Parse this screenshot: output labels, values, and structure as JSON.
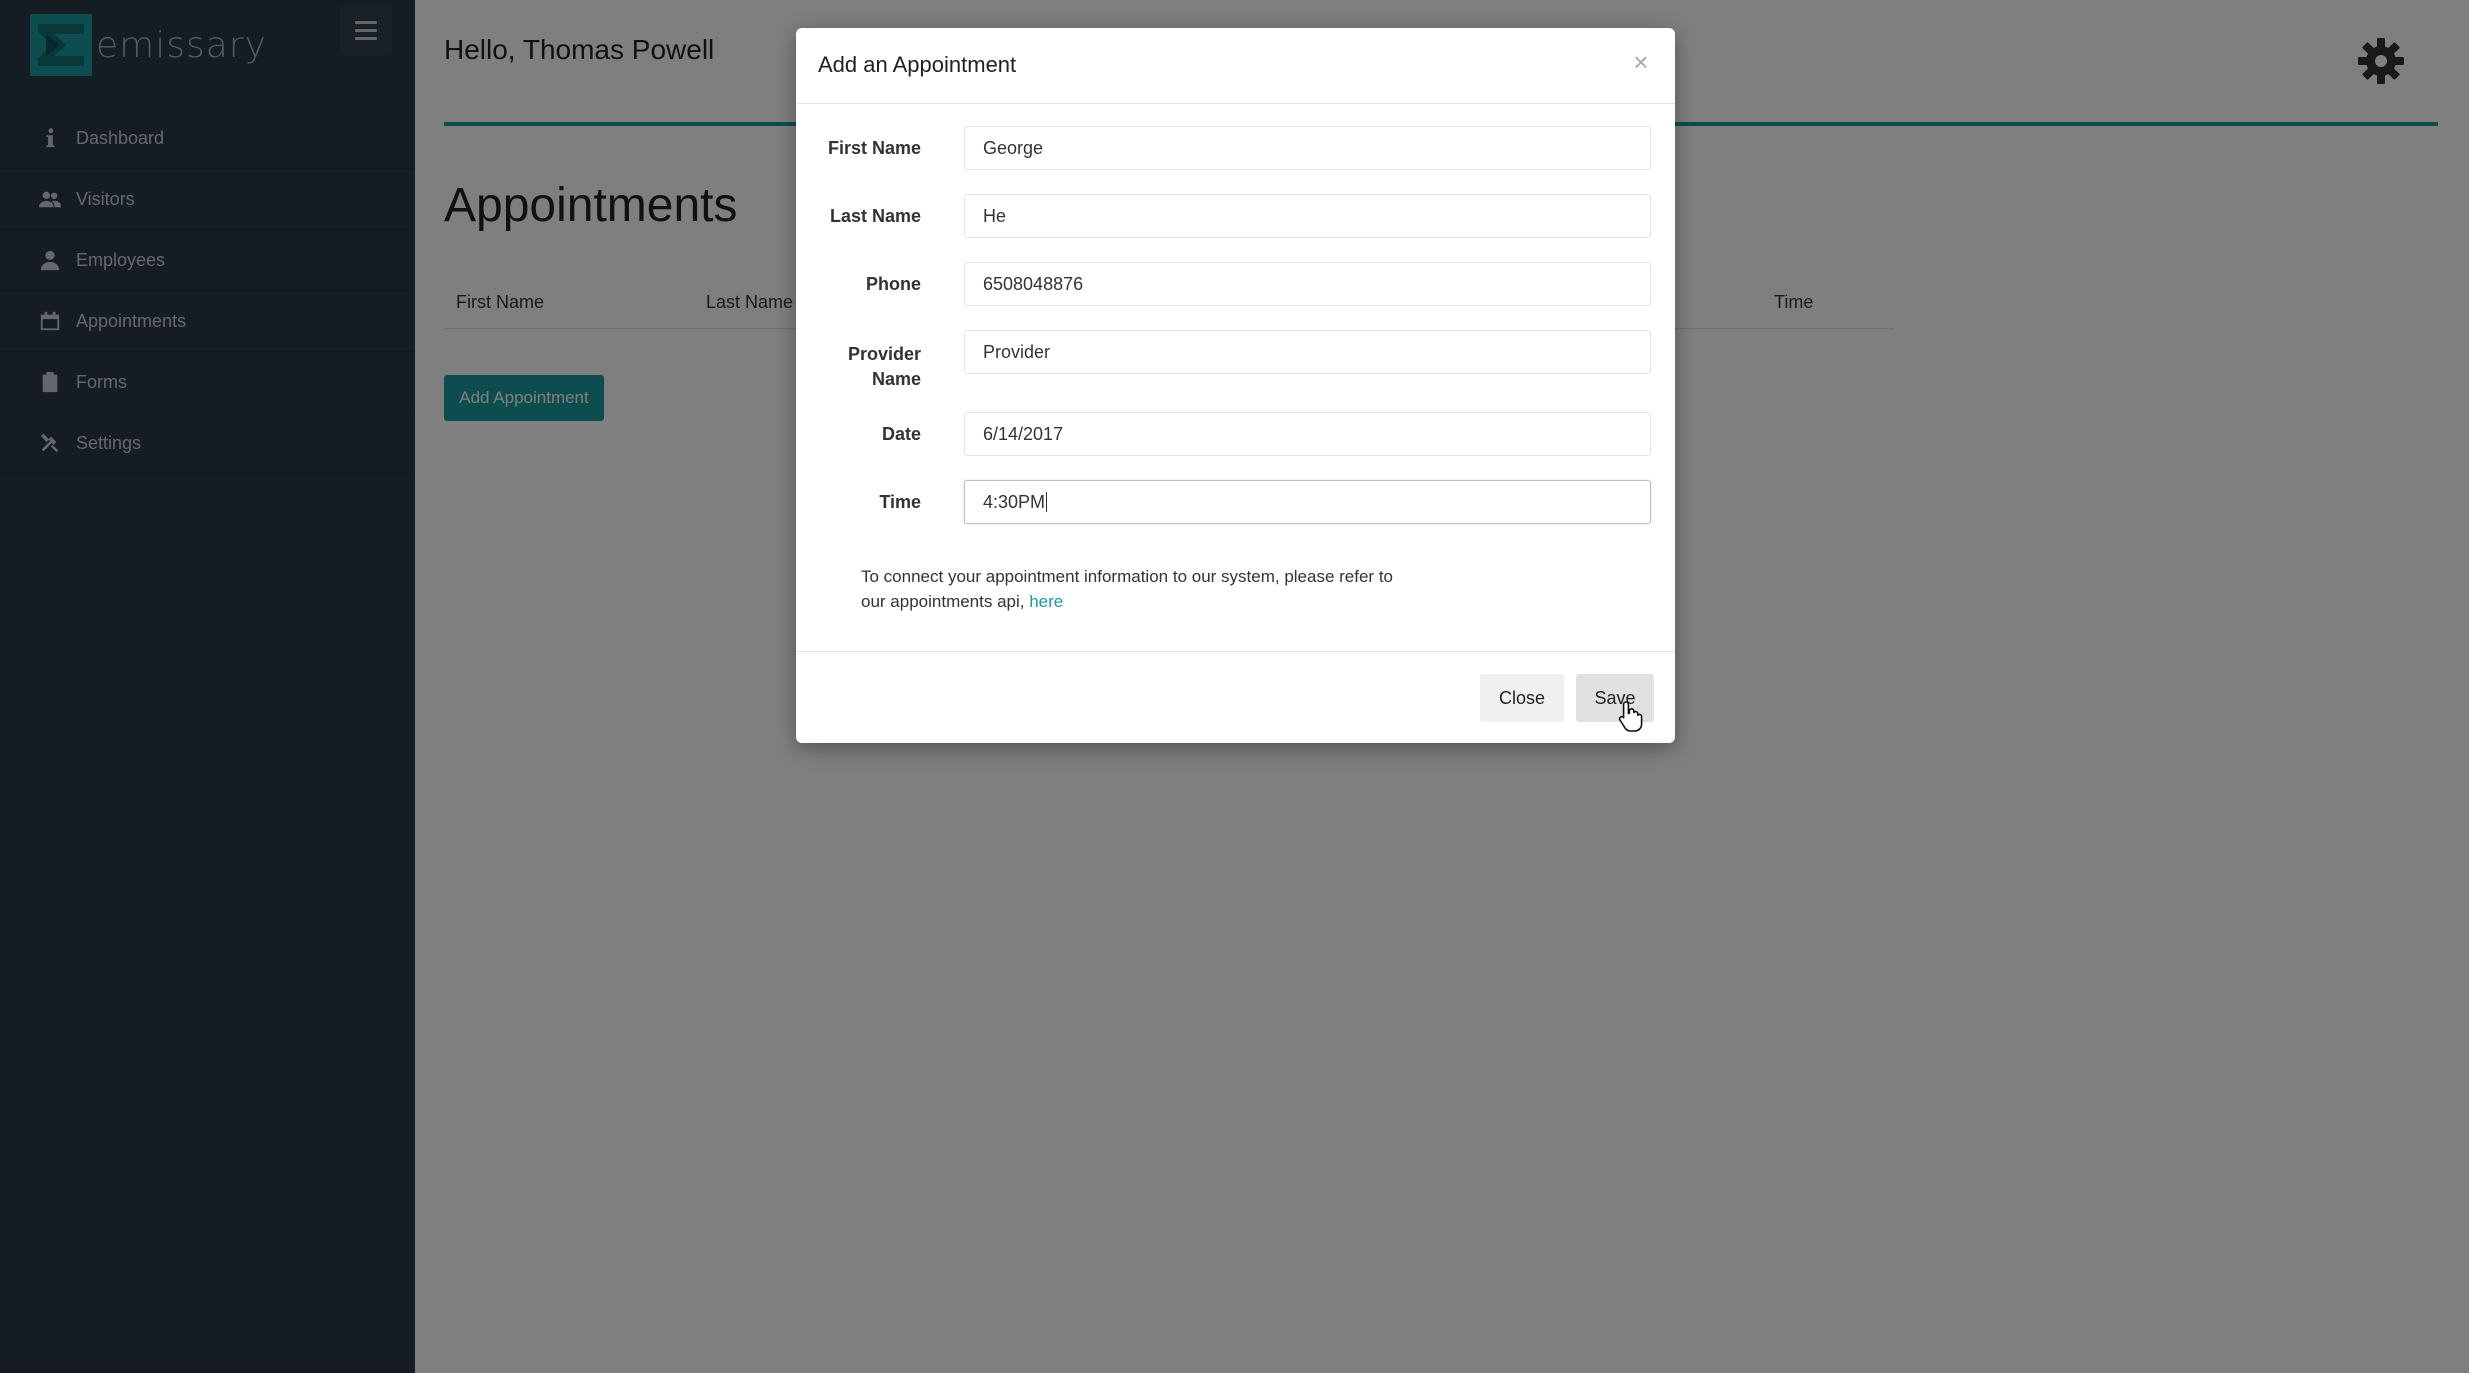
{
  "app": {
    "logo_text": "emissary",
    "brand_color": "#1b9ba0",
    "sidebar_color": "#2c3848"
  },
  "sidebar": {
    "items": [
      {
        "label": "Dashboard",
        "icon": "info-icon"
      },
      {
        "label": "Visitors",
        "icon": "users-icon"
      },
      {
        "label": "Employees",
        "icon": "user-icon"
      },
      {
        "label": "Appointments",
        "icon": "calendar-icon"
      },
      {
        "label": "Forms",
        "icon": "clipboard-icon"
      },
      {
        "label": "Settings",
        "icon": "tools-icon"
      }
    ]
  },
  "header": {
    "greeting": "Hello, Thomas Powell",
    "settings_icon": "gear-icon"
  },
  "main": {
    "title": "Appointments",
    "table_headers": [
      "First Name",
      "Last Name",
      "Time"
    ],
    "add_button": "Add Appointment"
  },
  "modal": {
    "title": "Add an Appointment",
    "close_icon": "close-icon",
    "fields": [
      {
        "label": "First Name",
        "value": "George"
      },
      {
        "label": "Last Name",
        "value": "He"
      },
      {
        "label": "Phone",
        "value": "6508048876"
      },
      {
        "label": "Provider Name",
        "value": "Provider"
      },
      {
        "label": "Date",
        "value": "6/14/2017"
      },
      {
        "label": "Time",
        "value": "4:30PM"
      }
    ],
    "note_text": "To connect your appointment information to our system, please refer to our appointments api, ",
    "note_link": "here",
    "close_button": "Close",
    "save_button": "Save"
  }
}
